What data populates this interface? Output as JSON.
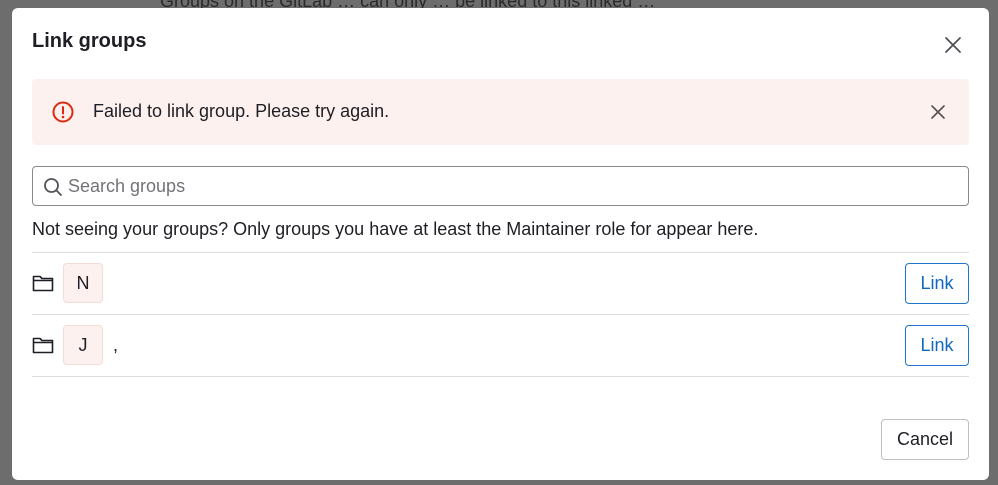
{
  "backdrop": {
    "text": "Groups on the GitLab … can only … be linked to this linked …"
  },
  "modal": {
    "title": "Link groups",
    "alert": {
      "message": "Failed to link group. Please try again."
    },
    "search": {
      "placeholder": "Search groups",
      "value": ""
    },
    "hint": "Not seeing your groups? Only groups you have at least the Maintainer role for appear here.",
    "groups": [
      {
        "avatar_letter": "N",
        "name": "",
        "link_label": "Link"
      },
      {
        "avatar_letter": "J",
        "name": ",",
        "link_label": "Link"
      }
    ],
    "cancel_label": "Cancel"
  },
  "icons": {
    "close": "close-icon",
    "alert": "error-icon",
    "search": "search-icon",
    "folder": "folder-icon"
  },
  "colors": {
    "alert_background": "#fcf1ef",
    "alert_icon": "#dd2b0e",
    "link": "#1068bf",
    "text": "#1f1e24"
  }
}
